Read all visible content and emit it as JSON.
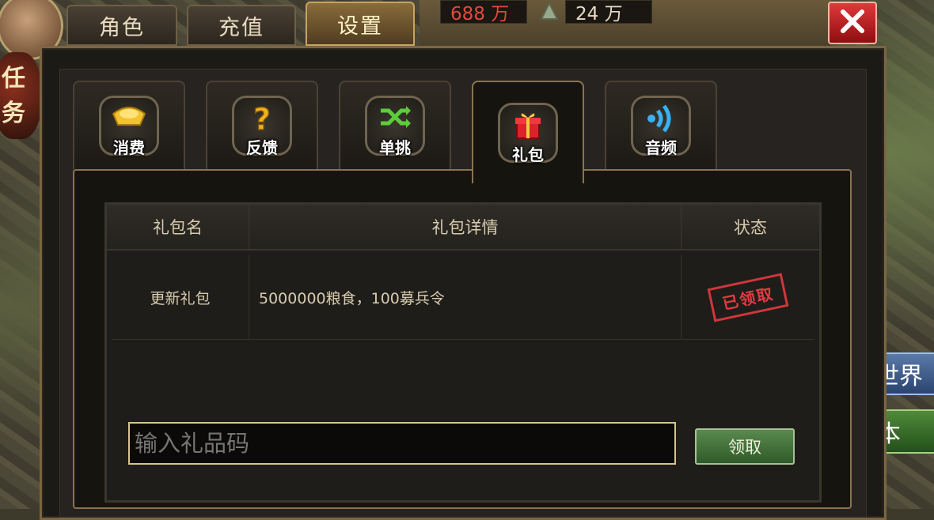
{
  "top_tabs": [
    {
      "label": "角色",
      "active": false
    },
    {
      "label": "充值",
      "active": false
    },
    {
      "label": "设置",
      "active": true
    }
  ],
  "resources": {
    "food": "688 万",
    "troops": "24 万"
  },
  "side": {
    "quest_label": "任务",
    "world_label": "世界",
    "dungeon_label": "本"
  },
  "icon_tabs": [
    {
      "label": "消费",
      "icon": "gold-ingot-icon",
      "active": false
    },
    {
      "label": "反馈",
      "icon": "question-icon",
      "active": false
    },
    {
      "label": "单挑",
      "icon": "shuffle-icon",
      "active": false
    },
    {
      "label": "礼包",
      "icon": "gift-icon",
      "active": true
    },
    {
      "label": "音频",
      "icon": "audio-icon",
      "active": false
    }
  ],
  "table": {
    "headers": [
      "礼包名",
      "礼包详情",
      "状态"
    ],
    "rows": [
      {
        "name": "更新礼包",
        "details": "5000000粮食，100募兵令",
        "status": "已领取"
      }
    ]
  },
  "redeem": {
    "placeholder": "输入礼品码",
    "button_label": "领取"
  },
  "colors": {
    "accent_gold": "#c7a462",
    "stamp_red": "#d0363c",
    "button_green": "#4f7d44",
    "close_red": "#c7272a"
  }
}
